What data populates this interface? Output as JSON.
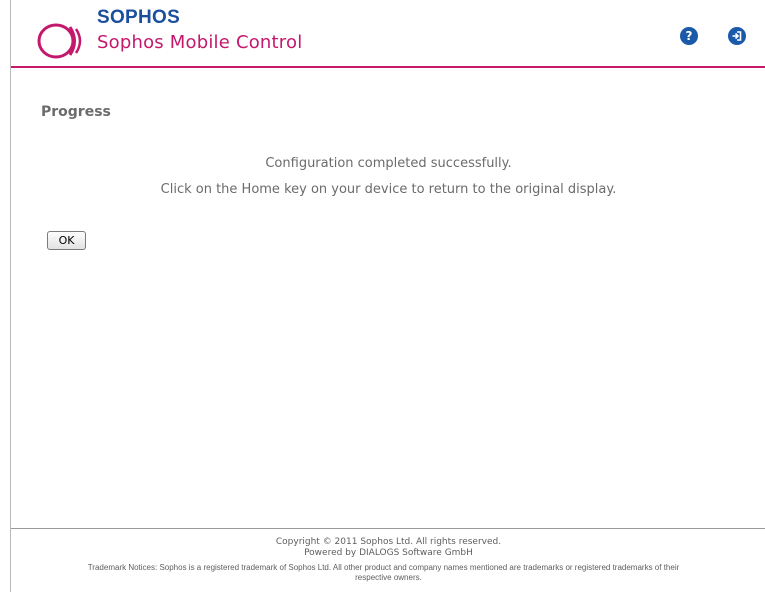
{
  "header": {
    "brand": "SOPHOS",
    "product": "Sophos Mobile Control",
    "logo_icon": "sophos-logo-icon",
    "help_icon": "help-icon",
    "help_glyph": "?",
    "logout_icon": "logout-icon",
    "accent_color": "#c4186c",
    "brand_color": "#1b4e9e"
  },
  "main": {
    "title": "Progress",
    "message_line1": "Configuration completed successfully.",
    "message_line2": "Click on the Home key on your device to return to the original display.",
    "ok_label": "OK"
  },
  "footer": {
    "copyright": "Copyright © 2011 Sophos Ltd. All rights reserved.",
    "powered_by": "Powered by DIALOGS Software GmbH",
    "trademark": "Trademark Notices: Sophos is a registered trademark of Sophos Ltd. All other product and company names mentioned are trademarks or registered trademarks of their",
    "trademark_cont": "respective owners."
  }
}
